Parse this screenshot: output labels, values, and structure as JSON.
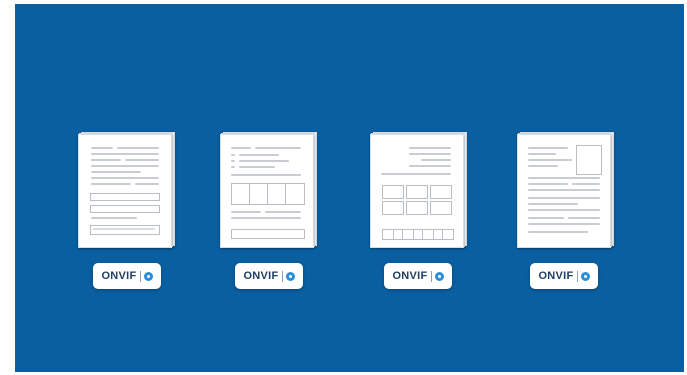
{
  "badges": [
    {
      "brand": "ONVIF",
      "trademark": "®",
      "icon": "profile-circle-icon"
    },
    {
      "brand": "ONVIF",
      "trademark": "®",
      "icon": "profile-circle-icon"
    },
    {
      "brand": "ONVIF",
      "trademark": "®",
      "icon": "profile-circle-icon"
    },
    {
      "brand": "ONVIF",
      "trademark": "®",
      "icon": "profile-circle-icon"
    }
  ],
  "colors": {
    "background": "#0a5fa0",
    "document": "#ffffff",
    "placeholder_line": "#c9cdd2",
    "badge_text": "#1f3e63",
    "profile_icon": "#2a8fd8"
  },
  "document_icons": [
    "form-document-icon",
    "table-document-icon",
    "grid-document-icon",
    "image-document-icon"
  ]
}
